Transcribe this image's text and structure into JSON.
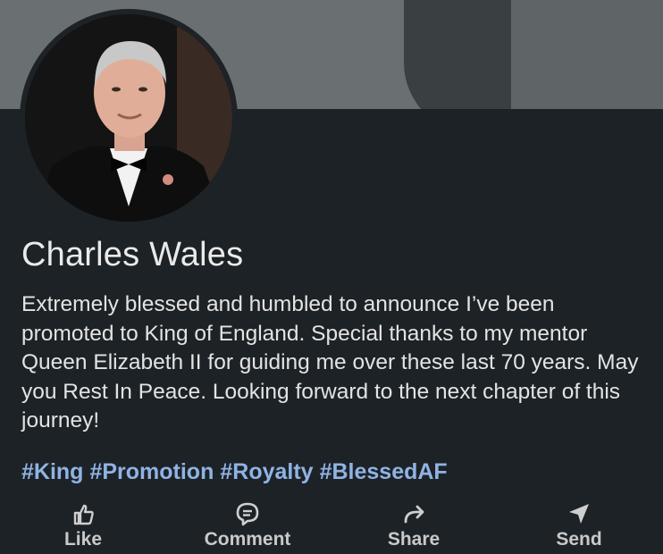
{
  "post": {
    "author_name": "Charles Wales",
    "text": "Extremely blessed and humbled to announce I’ve been promoted to King of England. Special thanks to my mentor Queen Elizabeth II for guiding me over these last 70 years. May you Rest In Peace. Looking forward to the next chapter of this journey!",
    "hashtags": [
      "#King",
      "#Promotion",
      "#Royalty",
      "#BlessedAF"
    ]
  },
  "actions": {
    "like": {
      "label": "Like",
      "icon": "thumbs-up-icon"
    },
    "comment": {
      "label": "Comment",
      "icon": "speech-bubble-icon"
    },
    "share": {
      "label": "Share",
      "icon": "share-arrow-icon"
    },
    "send": {
      "label": "Send",
      "icon": "paper-plane-icon"
    }
  },
  "colors": {
    "background": "#1d2226",
    "hashtag": "#8fb3e4",
    "action_text": "#c9c9c9"
  }
}
